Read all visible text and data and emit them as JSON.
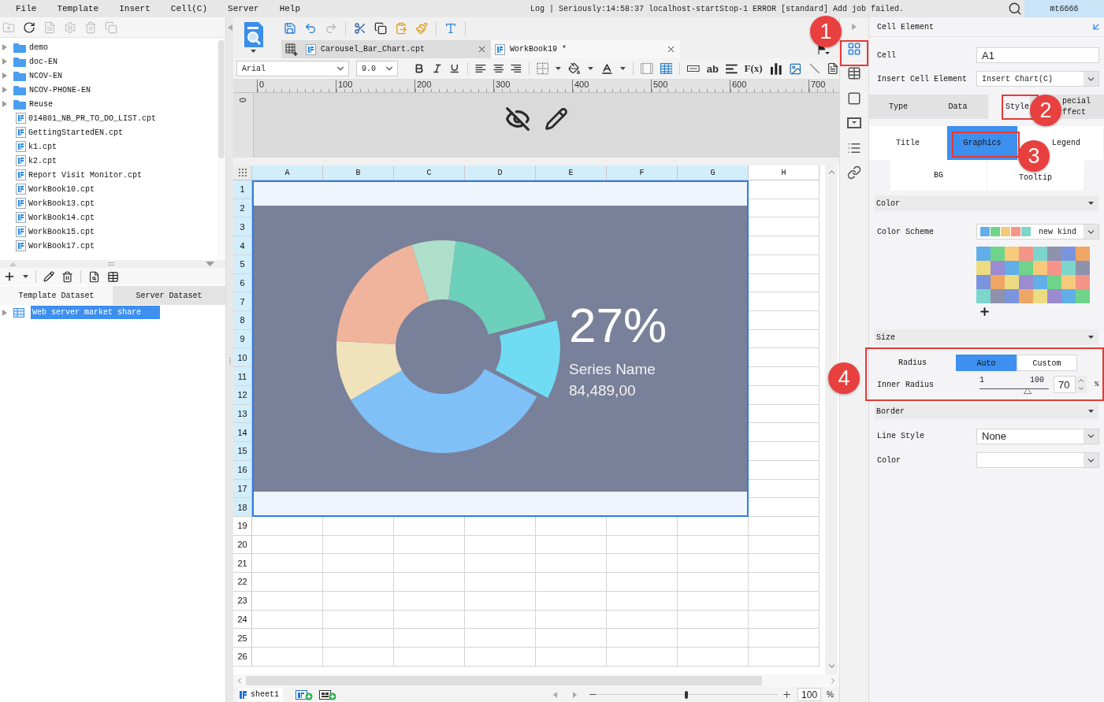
{
  "menu_bar": {
    "items": [
      "File",
      "Template",
      "Insert",
      "Cell(C)",
      "Server",
      "Help"
    ],
    "log": "Log | Seriously:14:58:37 localhost-startStop-1 ERROR [standard] Add job failed.",
    "user": "mt6666"
  },
  "file_toolbar": [
    {
      "disabled": true
    },
    {
      "disabled": false
    },
    {
      "disabled": true
    },
    {
      "disabled": true
    },
    {
      "disabled": true
    },
    {
      "disabled": true
    }
  ],
  "file_tree": [
    {
      "label": "demo",
      "kind": "folder"
    },
    {
      "label": "doc-EN",
      "kind": "folder"
    },
    {
      "label": "NCOV-EN",
      "kind": "folder"
    },
    {
      "label": "NCOV-PHONE-EN",
      "kind": "folder"
    },
    {
      "label": "Reuse",
      "kind": "folder"
    },
    {
      "label": "014801_NB_PR_TO_DO_LIST.cpt",
      "kind": "file"
    },
    {
      "label": "GettingStartedEN.cpt",
      "kind": "file"
    },
    {
      "label": "k1.cpt",
      "kind": "file"
    },
    {
      "label": "k2.cpt",
      "kind": "file"
    },
    {
      "label": "Report Visit Monitor.cpt",
      "kind": "file"
    },
    {
      "label": "WorkBook10.cpt",
      "kind": "file"
    },
    {
      "label": "WorkBook13.cpt",
      "kind": "file"
    },
    {
      "label": "WorkBook14.cpt",
      "kind": "file"
    },
    {
      "label": "WorkBook15.cpt",
      "kind": "file"
    },
    {
      "label": "WorkBook17.cpt",
      "kind": "file"
    }
  ],
  "dataset_tabs": [
    {
      "label": "Template Dataset",
      "selected": true
    },
    {
      "label": "Server Dataset",
      "selected": false
    }
  ],
  "datasets": [
    {
      "label": "Web server market share",
      "selected": true
    }
  ],
  "main_toolbar": [
    {
      "disabled": false
    },
    {
      "disabled": false
    },
    {
      "disabled": true
    },
    {
      "disabled": false
    },
    {
      "disabled": false
    },
    {
      "disabled": false
    },
    {
      "disabled": false
    },
    {
      "disabled": false
    }
  ],
  "tabs": [
    {
      "label": "Carousel_Bar_Chart.cpt",
      "selected": false
    },
    {
      "label": "WorkBook19 *",
      "selected": true
    }
  ],
  "format_bar": {
    "font": "Arial",
    "size": "9.0",
    "text_tool": "ab",
    "formula_tool": "F(x)"
  },
  "ruler": {
    "labels": [
      "0",
      "100",
      "200",
      "300",
      "400",
      "500",
      "600",
      "700"
    ],
    "vertical_label": "0"
  },
  "sheet": {
    "columns": [
      {
        "label": "A",
        "selected": true
      },
      {
        "label": "B",
        "selected": true
      },
      {
        "label": "C",
        "selected": true
      },
      {
        "label": "D",
        "selected": true
      },
      {
        "label": "E",
        "selected": true
      },
      {
        "label": "F",
        "selected": true
      },
      {
        "label": "G",
        "selected": true
      },
      {
        "label": "H",
        "selected": false
      }
    ],
    "rows": [
      {
        "label": "1",
        "selected": true
      },
      {
        "label": "2",
        "selected": true
      },
      {
        "label": "3",
        "selected": true
      },
      {
        "label": "4",
        "selected": true
      },
      {
        "label": "5",
        "selected": true
      },
      {
        "label": "6",
        "selected": true
      },
      {
        "label": "7",
        "selected": true
      },
      {
        "label": "8",
        "selected": true
      },
      {
        "label": "9",
        "selected": true
      },
      {
        "label": "10",
        "selected": true
      },
      {
        "label": "11",
        "selected": true
      },
      {
        "label": "12",
        "selected": true
      },
      {
        "label": "13",
        "selected": true
      },
      {
        "label": "14",
        "selected": true
      },
      {
        "label": "15",
        "selected": true
      },
      {
        "label": "16",
        "selected": true
      },
      {
        "label": "17",
        "selected": true
      },
      {
        "label": "18",
        "selected": true
      },
      {
        "label": "19",
        "selected": false
      },
      {
        "label": "20",
        "selected": false
      },
      {
        "label": "21",
        "selected": false
      },
      {
        "label": "22",
        "selected": false
      },
      {
        "label": "23",
        "selected": false
      },
      {
        "label": "24",
        "selected": false
      },
      {
        "label": "25",
        "selected": false
      },
      {
        "label": "26",
        "selected": false
      }
    ],
    "chart": {
      "percent": "27%",
      "series_name": "Series Name",
      "value": "84,489,00"
    }
  },
  "sheet_bar": {
    "sheets": [
      {
        "label": "sheet1",
        "selected": true
      }
    ],
    "zoom": {
      "level": 0.49,
      "value": "100",
      "unit": "%"
    }
  },
  "side_tabs": [
    {
      "selected": true
    },
    {
      "selected": false
    },
    {
      "selected": false
    },
    {
      "selected": false
    },
    {
      "selected": false
    },
    {
      "selected": false
    }
  ],
  "properties": {
    "title": "Cell Element",
    "cell": {
      "label": "Cell",
      "value": "A1"
    },
    "insert": {
      "label": "Insert Cell Element",
      "value": "Insert Chart(C)"
    },
    "tabs": [
      {
        "label": "Type",
        "selected": false
      },
      {
        "label": "Data",
        "selected": false
      },
      {
        "label": "Style",
        "selected": true
      },
      {
        "label": "pecial ffect",
        "selected": false
      }
    ],
    "style_tabs": [
      {
        "label": "Title",
        "selected": false
      },
      {
        "label": "Graphics",
        "selected": true
      },
      {
        "label": "Legend",
        "selected": false
      },
      {
        "label": "BG",
        "selected": false
      },
      {
        "label": "Tooltip",
        "selected": false
      }
    ],
    "color_section": {
      "title": "Color",
      "scheme_label": "Color Scheme",
      "scheme_value": "new kind",
      "scheme_swatches": [
        {
          "color": "#62aee8"
        },
        {
          "color": "#6fd48a"
        },
        {
          "color": "#f7c97a"
        },
        {
          "color": "#f5958a"
        },
        {
          "color": "#7dd6cc"
        }
      ],
      "palette": [
        {
          "color": "#62aee8"
        },
        {
          "color": "#6fd48a"
        },
        {
          "color": "#f7c97a"
        },
        {
          "color": "#f5958a"
        },
        {
          "color": "#7dd6cc"
        },
        {
          "color": "#8e92ad"
        },
        {
          "color": "#7a95dd"
        },
        {
          "color": "#efa665"
        },
        {
          "color": "#ecdb80"
        },
        {
          "color": "#9b8bd0"
        },
        {
          "color": "#62aee8"
        },
        {
          "color": "#6fd48a"
        },
        {
          "color": "#f7c97a"
        },
        {
          "color": "#f5958a"
        },
        {
          "color": "#7dd6cc"
        },
        {
          "color": "#8e92ad"
        },
        {
          "color": "#7a95dd"
        },
        {
          "color": "#efa665"
        },
        {
          "color": "#ecdb80"
        },
        {
          "color": "#9b8bd0"
        },
        {
          "color": "#62aee8"
        },
        {
          "color": "#6fd48a"
        },
        {
          "color": "#f7c97a"
        },
        {
          "color": "#f5958a"
        },
        {
          "color": "#7dd6cc"
        },
        {
          "color": "#8e92ad"
        },
        {
          "color": "#7a95dd"
        },
        {
          "color": "#efa665"
        },
        {
          "color": "#ecdb80"
        },
        {
          "color": "#9b8bd0"
        },
        {
          "color": "#62aee8"
        },
        {
          "color": "#6fd48a"
        }
      ]
    },
    "size_section": {
      "title": "Size",
      "radius_label": "Radius",
      "radius_options": [
        {
          "label": "Auto",
          "selected": true
        },
        {
          "label": "Custom",
          "selected": false
        }
      ],
      "inner_radius": {
        "label": "Inner Radius",
        "min": "1",
        "max": "100",
        "level": 0.69,
        "value": "70",
        "unit": "%"
      }
    },
    "border_section": {
      "title": "Border",
      "line_style": {
        "label": "Line Style",
        "value": "None"
      },
      "color": {
        "label": "Color"
      }
    }
  },
  "callouts": [
    {
      "label": "1"
    },
    {
      "label": "2"
    },
    {
      "label": "3"
    },
    {
      "label": "4"
    }
  ]
}
